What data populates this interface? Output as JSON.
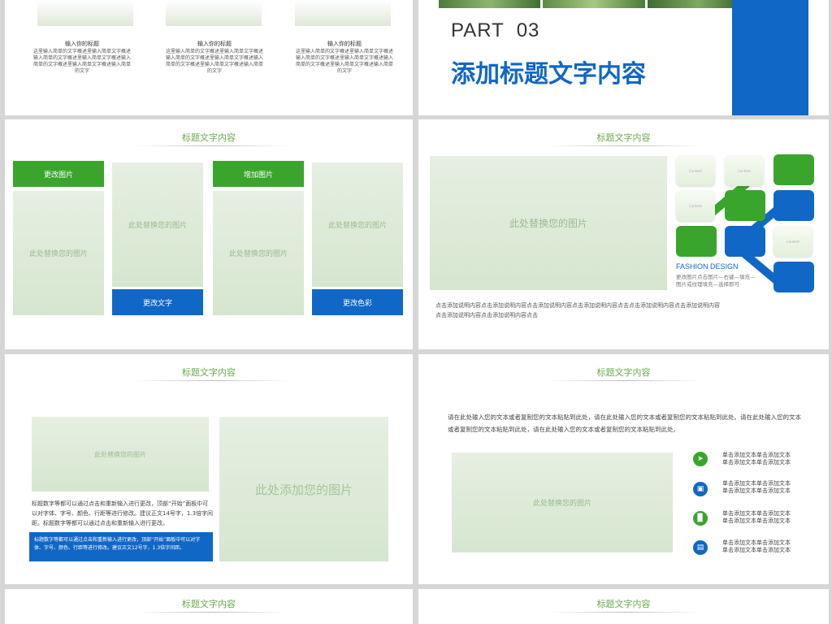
{
  "slide1": {
    "columns": [
      {
        "title": "输入你的标题",
        "body": "这里输入简单的文字概述里输入简单文字概述输入简单的文字概述里输入简单文字概述输入简单的文字概述里输入简单文字概述输入简单的文字"
      },
      {
        "title": "输入你的标题",
        "body": "这里输入简单的文字概述里输入简单文字概述输入简单的文字概述里输入简单文字概述输入简单的文字概述里输入简单文字概述输入简单的文字"
      },
      {
        "title": "输入你的标题",
        "body": "这里输入简单的文字概述里输入简单文字概述输入简单的文字概述里输入简单文字概述输入简单的文字概述里输入简单文字概述输入简单的文字"
      }
    ]
  },
  "slide2": {
    "part_label": "PART  03",
    "title": "添加标题文字内容"
  },
  "slide3": {
    "title": "标题文字内容",
    "btn_change_image": "更改图片",
    "btn_add_image": "增加图片",
    "btn_change_text": "更改文字",
    "btn_change_color": "更改色彩",
    "placeholder": "此处替换您的图片"
  },
  "slide4": {
    "title": "标题文字内容",
    "placeholder": "此处替换您的图片",
    "fashion_title": "FASHION DESIGN",
    "fashion_desc_1": "更改图片点击图片—右键—填充—",
    "fashion_desc_2": "图片或纹理填充—选择即可",
    "card_label": "Content",
    "caption_1": "点击添加说明内容点击添加说明内容点击添加说明内容点击添加说明内容点击点击添加说明内容点击添加说明内容",
    "caption_2": "点击添加说明内容点击添加说明内容点击"
  },
  "slide5": {
    "title": "标题文字内容",
    "placeholder_small": "此处替换您的图片",
    "placeholder_big": "此处添加您的图片",
    "body": "标题数字等都可以通过点击和重新输入进行更改，顶部“开始”面板中可以对字体、字号、颜色、行距等进行修改。建议正文14号字，1.3倍字间距。标题数字等都可以通过点击和重新输入进行更改。",
    "blue_body": "标题数字等都可以通过点击和重新输入进行更改，顶部“开始”面板中可以对字体、字号、颜色、行距等进行修改。建议正文12号字，1.3倍字间距。"
  },
  "slide6": {
    "title": "标题文字内容",
    "intro": "请在此处输入您的文本或者复制您的文本粘贴到此处，请在此处输入您的文本或者复制您的文本粘贴到此处。请在此处输入您的文本或者复制您的文本粘贴到此处，请在此处输入您的文本或者复制您的文本粘贴到此处。",
    "placeholder": "此处替换您的图片",
    "items": [
      {
        "line1": "单击添加文本单击添加文本",
        "line2": "单击添加文本单击添加文本"
      },
      {
        "line1": "单击添加文本单击添加文本",
        "line2": "单击添加文本单击添加文本"
      },
      {
        "line1": "单击添加文本单击添加文本",
        "line2": "单击添加文本单击添加文本"
      },
      {
        "line1": "单击添加文本单击添加文本",
        "line2": "单击添加文本单击添加文本"
      }
    ]
  },
  "slide7": {
    "title": "标题文字内容"
  },
  "slide8": {
    "title": "标题文字内容"
  },
  "colors": {
    "green": "#3aa52d",
    "blue": "#1167c6",
    "title_green": "#6aa84f"
  }
}
